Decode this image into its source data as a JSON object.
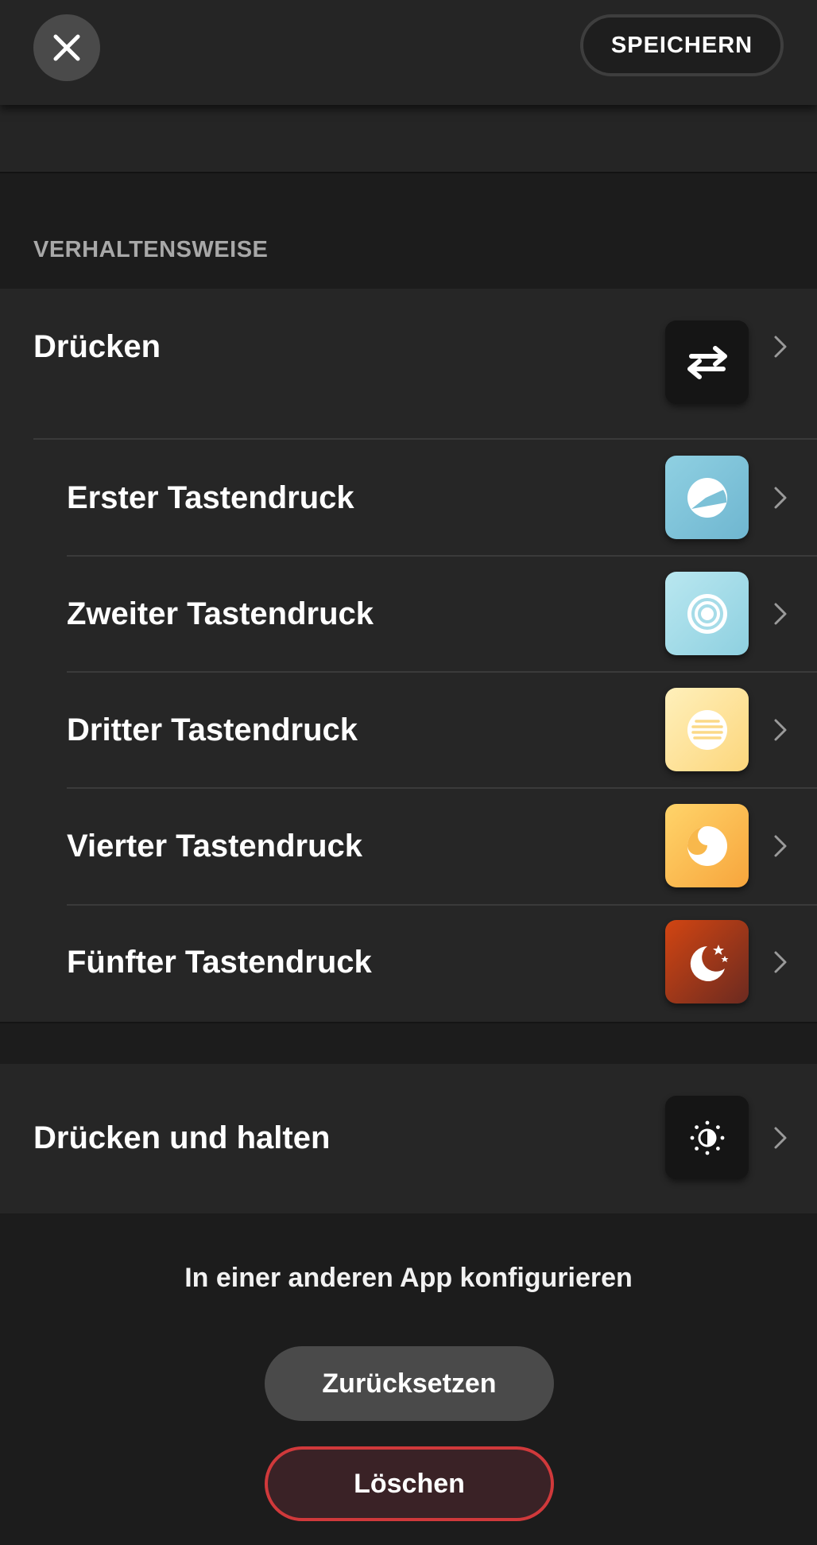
{
  "header": {
    "close_icon": "close-icon",
    "save_label": "SPEICHERN"
  },
  "behavior": {
    "section_title": "VERHALTENSWEISE",
    "press": {
      "label": "Drücken",
      "icon": "swap-arrows-icon",
      "tile_color": "#151515"
    },
    "presses": [
      {
        "label": "Erster Tastendruck",
        "icon": "dial-icon",
        "tile_colors": [
          "#8fd0e2",
          "#6fb6d0"
        ]
      },
      {
        "label": "Zweiter Tastendruck",
        "icon": "concentric-circles-icon",
        "tile_colors": [
          "#b9e7f0",
          "#8ed0e0"
        ]
      },
      {
        "label": "Dritter Tastendruck",
        "icon": "lines-circle-icon",
        "tile_colors": [
          "#fff0bb",
          "#fcd67c"
        ]
      },
      {
        "label": "Vierter Tastendruck",
        "icon": "yin-yang-icon",
        "tile_colors": [
          "#ffd46a",
          "#f7a53c"
        ]
      },
      {
        "label": "Fünfter Tastendruck",
        "icon": "moon-stars-icon",
        "tile_colors": [
          "#d24512",
          "#6b2a20"
        ]
      }
    ],
    "press_and_hold": {
      "label": "Drücken und halten",
      "icon": "brightness-icon",
      "tile_color": "#151515"
    }
  },
  "footer": {
    "other_app_link": "In einer anderen App konfigurieren",
    "reset_label": "Zurücksetzen",
    "delete_label": "Löschen"
  }
}
